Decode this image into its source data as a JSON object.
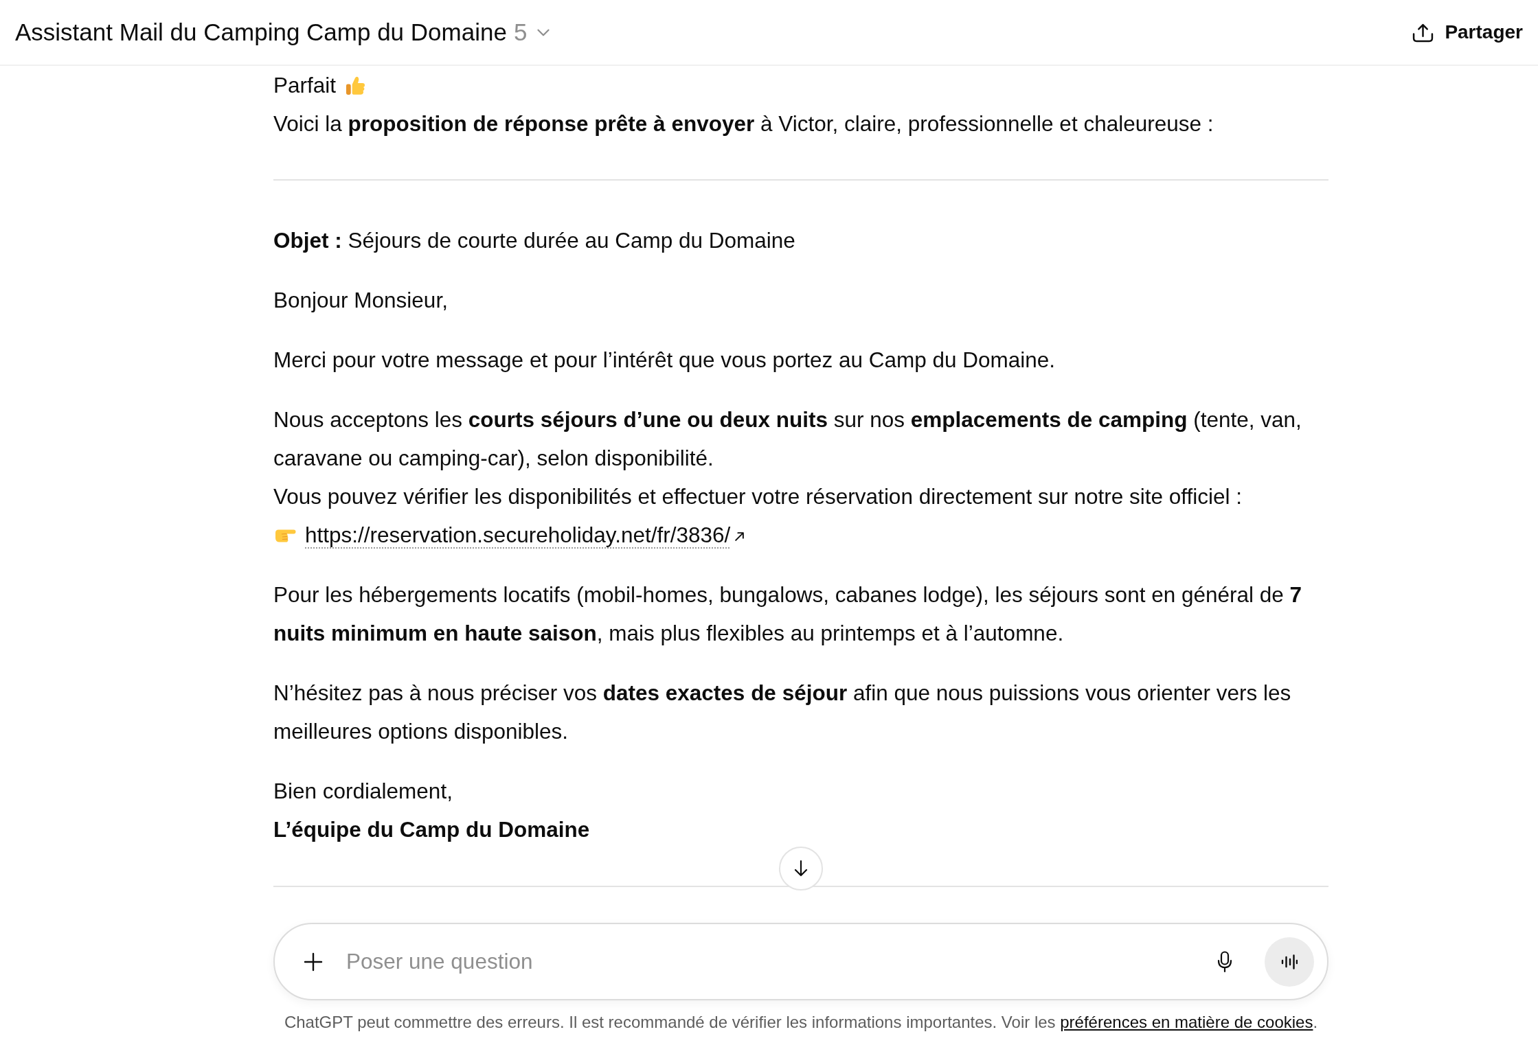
{
  "header": {
    "title": "Assistant Mail du Camping Camp du Domaine",
    "version": "5",
    "share": "Partager"
  },
  "message": {
    "greeting": "Parfait",
    "intro": "Voici la **proposition de réponse prête à envoyer** à Victor, claire, professionnelle et chaleureuse :",
    "email": {
      "subject": "**Objet :** Séjours de courte durée au Camp du Domaine",
      "paragraphs": [
        {
          "lines": [
            "Bonjour Monsieur,"
          ]
        },
        {
          "lines": [
            "Merci pour votre message et pour l’intérêt que vous portez au Camp du Domaine."
          ]
        },
        {
          "lines": [
            "Nous acceptons les **courts séjours d’une ou deux nuits** sur nos **emplacements de camping** (tente, van, caravane ou camping-car), selon disponibilité.",
            "Vous pouvez vérifier les disponibilités et effectuer votre réservation directement sur notre site officiel :"
          ],
          "link": "https://reservation.secureholiday.net/fr/3836/"
        },
        {
          "lines": [
            "Pour les hébergements locatifs (mobil-homes, bungalows, cabanes lodge), les séjours sont en général de **7 nuits minimum en haute saison**, mais plus flexibles au printemps et à l’automne."
          ]
        },
        {
          "lines": [
            "N’hésitez pas à nous préciser vos **dates exactes de séjour** afin que nous puissions vous orienter vers les meilleures options disponibles."
          ]
        }
      ],
      "closing": "Bien cordialement,",
      "signature": "L’équipe du Camp du Domaine"
    }
  },
  "composer": {
    "placeholder": "Poser une question"
  },
  "disclaimer": {
    "text": "ChatGPT peut commettre des erreurs. Il est recommandé de vérifier les informations importantes. Voir les",
    "link": "préférences en matière de cookies",
    "end": "."
  }
}
